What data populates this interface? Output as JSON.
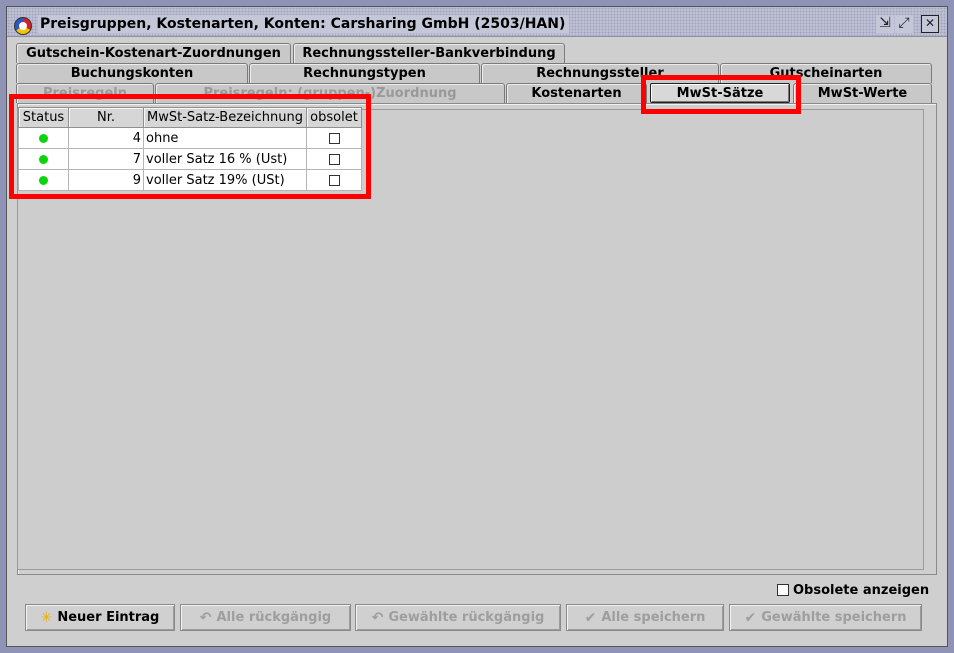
{
  "window": {
    "title": "Preisgruppen, Kostenarten, Konten: Carsharing GmbH (2503/HAN)",
    "min_glyph": "⇲",
    "max_glyph": "⤢",
    "close_glyph": "✕"
  },
  "tabs": {
    "row1": [
      "Gutschein-Kostenart-Zuordnungen",
      "Rechnungssteller-Bankverbindung"
    ],
    "row2": [
      "Buchungskonten",
      "Rechnungstypen",
      "Rechnungssteller",
      "Gutscheinarten"
    ],
    "row3": [
      "Preisregeln",
      "Preisregeln: (gruppen-)Zuordnung",
      "Kostenarten",
      "MwSt-Sätze",
      "MwSt-Werte"
    ],
    "selected": "MwSt-Sätze"
  },
  "table": {
    "headers": [
      "Status",
      "Nr.",
      "MwSt-Satz-Bezeichnung",
      "obsolet"
    ],
    "rows": [
      {
        "status": "active",
        "nr": "4",
        "name": "ohne",
        "obsolet": false
      },
      {
        "status": "active",
        "nr": "7",
        "name": "voller Satz 16 % (Ust)",
        "obsolet": false
      },
      {
        "status": "active",
        "nr": "9",
        "name": "voller Satz 19% (USt)",
        "obsolet": false
      }
    ]
  },
  "footer": {
    "show_obsolete_label": "Obsolete anzeigen",
    "buttons": {
      "new": "Neuer Eintrag",
      "undo_all": "Alle rückgängig",
      "undo_selected": "Gewählte rückgängig",
      "save_all": "Alle speichern",
      "save_selected": "Gewählte speichern"
    }
  },
  "colors": {
    "status_active": "#0ad40a",
    "highlight": "#ff0000"
  }
}
